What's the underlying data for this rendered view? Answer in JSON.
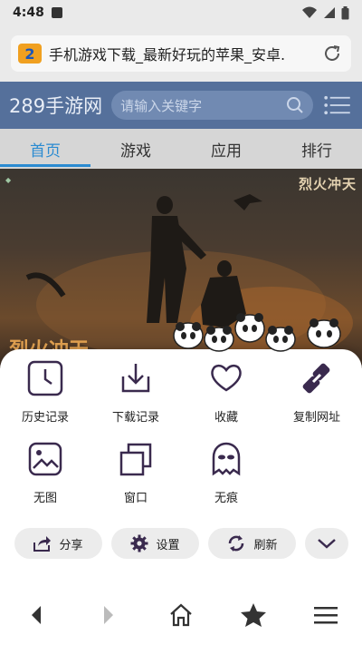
{
  "status_bar": {
    "time": "4:48",
    "icons": [
      "square-notification-icon",
      "wifi-icon",
      "cell-signal-icon",
      "battery-icon"
    ]
  },
  "address_bar": {
    "site_logo_letter": "2",
    "page_title": "手机游戏下载_最新好玩的苹果_安卓.",
    "refresh_icon": "refresh-icon"
  },
  "site_header": {
    "brand": "289手游网",
    "search_placeholder": "请输入关键字",
    "search_icon": "search-icon",
    "menu_icon": "menu-icon"
  },
  "nav_tabs": [
    {
      "label": "首页",
      "active": true
    },
    {
      "label": "游戏",
      "active": false
    },
    {
      "label": "应用",
      "active": false
    },
    {
      "label": "排行",
      "active": false
    }
  ],
  "banner": {
    "logo_right": "烈火冲天",
    "caption": "烈火冲天"
  },
  "sheet": {
    "items": [
      {
        "label": "历史记录",
        "icon": "history-clock-icon"
      },
      {
        "label": "下载记录",
        "icon": "download-icon"
      },
      {
        "label": "收藏",
        "icon": "heart-icon"
      },
      {
        "label": "复制网址",
        "icon": "link-icon"
      },
      {
        "label": "无图",
        "icon": "image-icon"
      },
      {
        "label": "窗口",
        "icon": "windows-icon"
      },
      {
        "label": "无痕",
        "icon": "incognito-ghost-icon"
      }
    ],
    "pills": [
      {
        "label": "分享",
        "icon": "share-icon"
      },
      {
        "label": "设置",
        "icon": "gear-icon"
      },
      {
        "label": "刷新",
        "icon": "refresh-icon"
      }
    ],
    "collapse_icon": "chevron-down-icon"
  },
  "bottom_nav": {
    "icons": [
      "back-arrow-icon",
      "forward-arrow-icon",
      "home-icon",
      "star-icon",
      "menu-icon"
    ]
  },
  "colors": {
    "accent": "#2b8bd1",
    "header_bg": "#3a5a8c",
    "icon_purple": "#3a2a4e"
  }
}
